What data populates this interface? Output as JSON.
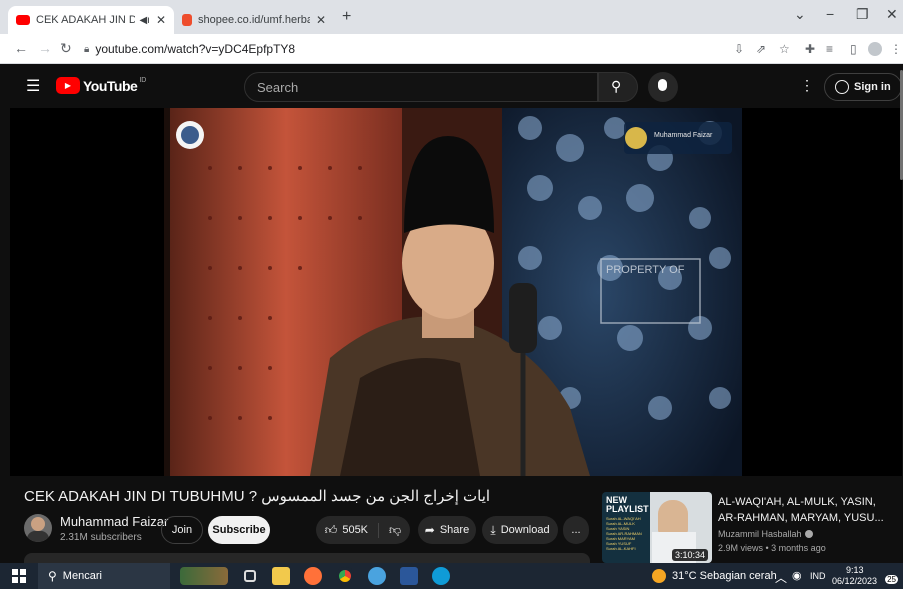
{
  "browser": {
    "tabs": [
      {
        "title": "CEK ADAKAH JIN DI TUBUH",
        "favicon_color": "#ff0000"
      },
      {
        "title": "shopee.co.id/umf.herbal?utm_c",
        "favicon_color": "#ee4d2d"
      }
    ],
    "new_tab": "+",
    "url": "youtube.com/watch?v=yDC4EpfpTY8"
  },
  "youtube": {
    "logo_text": "YouTube",
    "logo_region": "ID",
    "search_placeholder": "Search",
    "signin_label": "Sign in",
    "video": {
      "logo_overlay_text": "Muhammad Faizar",
      "watermark_text": "PROPERTY OF"
    },
    "title": "CEK ADAKAH JIN DI TUBUHMU ? ايات إخراج الجن من جسد الممسوس",
    "channel": {
      "name": "Muhammad Faizar",
      "subscribers": "2.31M subscribers"
    },
    "join_label": "Join",
    "subscribe_label": "Subscribe",
    "likes": "505K",
    "share_label": "Share",
    "download_label": "Download",
    "more_label": "...",
    "recommendation": {
      "title": "AL-WAQI'AH, AL-MULK, YASIN, AR-RAHMAN, MARYAM, YUSU...",
      "channel": "Muzammil Hasballah",
      "meta": "2.9M views • 3 months ago",
      "duration": "3:10:34",
      "thumb_heading": "NEW PLAYLIST",
      "thumb_lines": [
        "Surah AL-WAQI'AH",
        "Surah AL-MULK",
        "Surah YASIN",
        "Surah AR-RAHMAN",
        "Surah MARYAM",
        "Surah YUSUF",
        "Surah AL-KAHFI"
      ]
    }
  },
  "taskbar": {
    "search_placeholder": "Mencari",
    "weather": "31°C  Sebagian cerah",
    "language": "IND",
    "time": "9:13",
    "date": "06/12/2023",
    "notification_count": "25"
  }
}
